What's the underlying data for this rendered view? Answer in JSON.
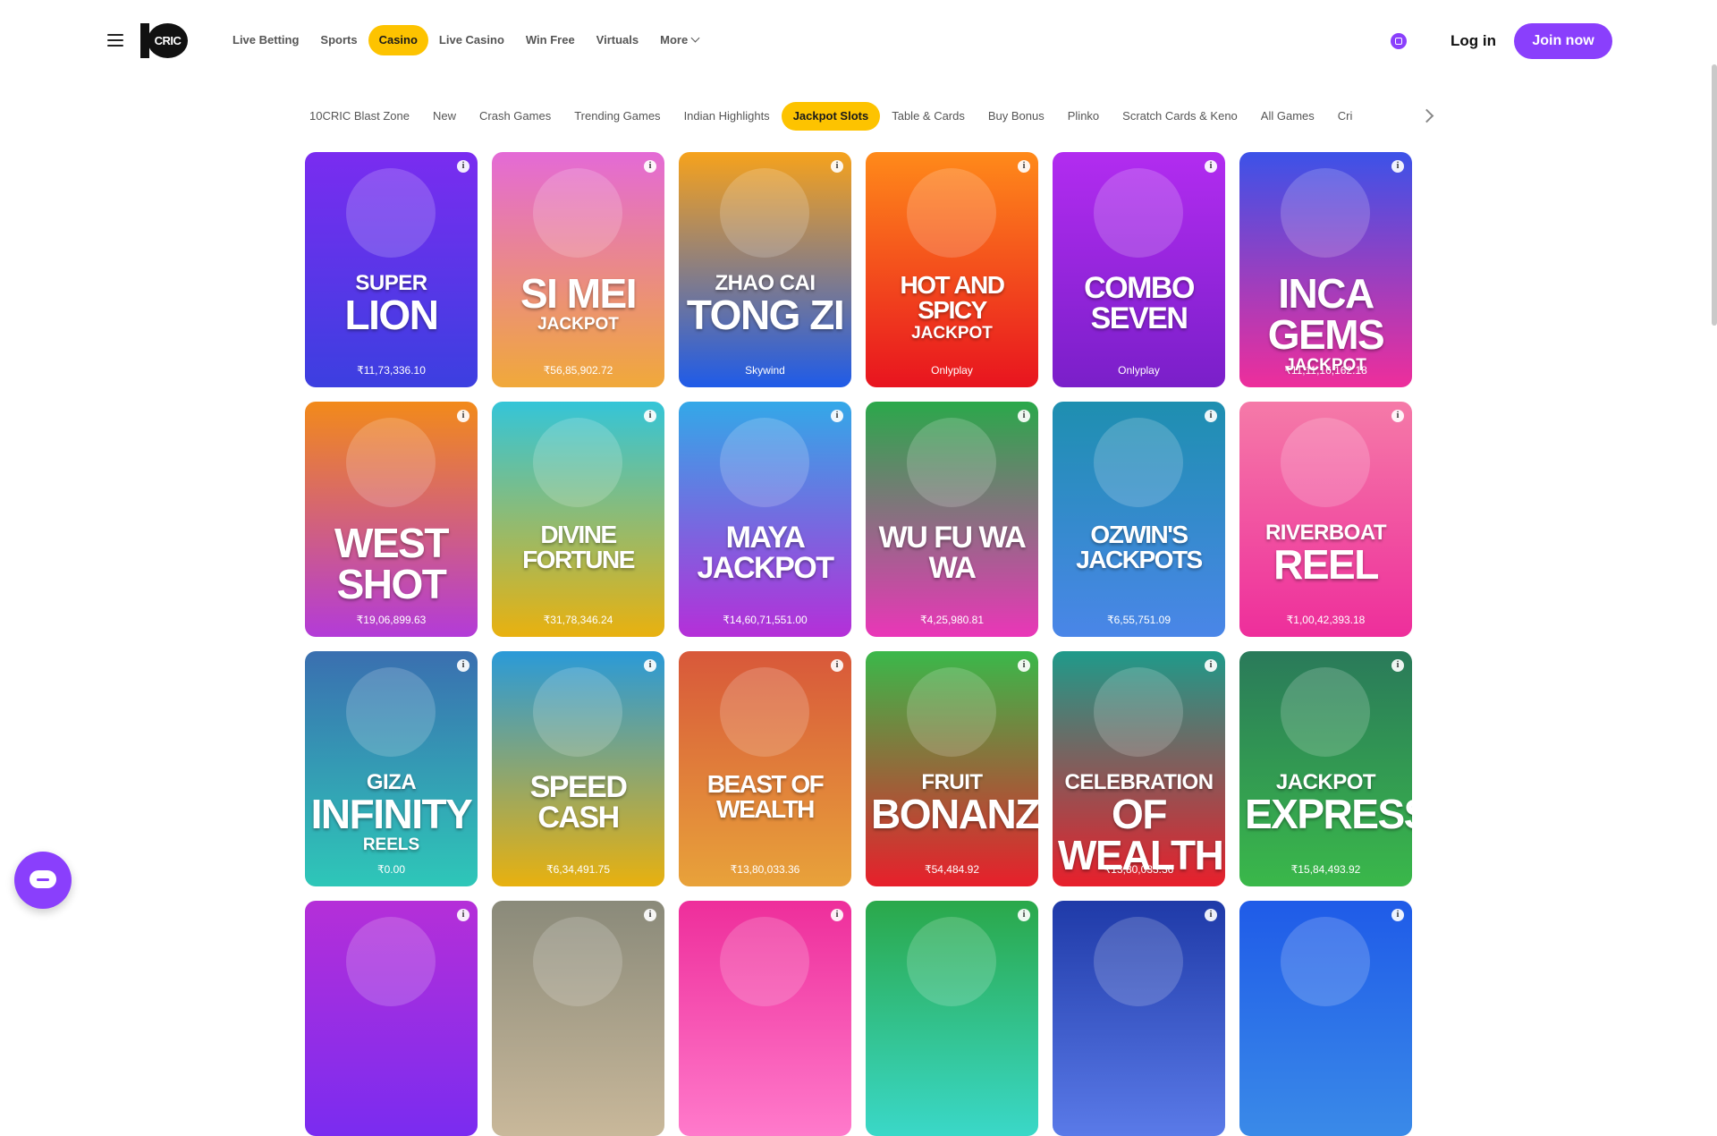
{
  "header": {
    "logo_text": "CRIC",
    "nav": [
      {
        "label": "Live Betting"
      },
      {
        "label": "Sports"
      },
      {
        "label": "Casino",
        "active": true
      },
      {
        "label": "Live Casino"
      },
      {
        "label": "Win Free"
      },
      {
        "label": "Virtuals"
      },
      {
        "label": "More"
      }
    ],
    "login_label": "Log in",
    "join_label": "Join now"
  },
  "tabs": [
    {
      "label": "10CRIC Blast Zone"
    },
    {
      "label": "New"
    },
    {
      "label": "Crash Games"
    },
    {
      "label": "Trending Games"
    },
    {
      "label": "Indian Highlights"
    },
    {
      "label": "Jackpot Slots",
      "active": true
    },
    {
      "label": "Table & Cards"
    },
    {
      "label": "Buy Bonus"
    },
    {
      "label": "Plinko"
    },
    {
      "label": "Scratch Cards & Keno"
    },
    {
      "label": "All Games"
    },
    {
      "label": "Cri"
    }
  ],
  "games": [
    {
      "top": "SUPER",
      "main": "LION",
      "sub": "",
      "meta": "₹11,73,336.10",
      "c1": "#7a2cf0",
      "c2": "#3c3fe0"
    },
    {
      "top": "",
      "main": "SI MEI",
      "sub": "JACKPOT",
      "meta": "₹56,85,902.72",
      "c1": "#e46ad6",
      "c2": "#f0a93a"
    },
    {
      "top": "ZHAO CAI",
      "main": "TONG ZI",
      "sub": "",
      "meta": "Skywind",
      "c1": "#f6a21c",
      "c2": "#1f5be8"
    },
    {
      "top": "",
      "main": "HOT AND SPICY",
      "sub": "JACKPOT",
      "meta": "Onlyplay",
      "c1": "#ff8a1a",
      "c2": "#e8141f"
    },
    {
      "top": "",
      "main": "COMBO SEVEN",
      "sub": "",
      "meta": "Onlyplay",
      "c1": "#b22cf0",
      "c2": "#7a1fc9"
    },
    {
      "top": "",
      "main": "INCA GEMS",
      "sub": "JACKPOT",
      "meta": "₹11,11,16,162.18",
      "c1": "#3c52e8",
      "c2": "#ee2e9b"
    },
    {
      "top": "",
      "main": "WEST SHOT",
      "sub": "",
      "meta": "₹19,06,899.63",
      "c1": "#f28a1a",
      "c2": "#b33bd8"
    },
    {
      "top": "",
      "main": "DIVINE FORTUNE",
      "sub": "",
      "meta": "₹31,78,346.24",
      "c1": "#34c5d8",
      "c2": "#e9b10f"
    },
    {
      "top": "",
      "main": "MAYA JACKPOT",
      "sub": "",
      "meta": "₹14,60,71,551.00",
      "c1": "#33a8e8",
      "c2": "#b52fd8"
    },
    {
      "top": "",
      "main": "WU FU WA WA",
      "sub": "",
      "meta": "₹4,25,980.81",
      "c1": "#2aa84a",
      "c2": "#ea36b8"
    },
    {
      "top": "",
      "main": "OZWIN'S JACKPOTS",
      "sub": "",
      "meta": "₹6,55,751.09",
      "c1": "#1e8fb0",
      "c2": "#4a86e8"
    },
    {
      "top": "RIVERBOAT",
      "main": "REEL",
      "sub": "",
      "meta": "₹1,00,42,393.18",
      "c1": "#f57aa8",
      "c2": "#ee2e9b"
    },
    {
      "top": "GIZA",
      "main": "INFINITY",
      "sub": "REELS",
      "meta": "₹0.00",
      "c1": "#3a6fb0",
      "c2": "#2ec7b8"
    },
    {
      "top": "",
      "main": "SPEED CASH",
      "sub": "",
      "meta": "₹6,34,491.75",
      "c1": "#2a9ad8",
      "c2": "#e8b10f"
    },
    {
      "top": "",
      "main": "BEAST OF WEALTH",
      "sub": "",
      "meta": "₹13,80,033.36",
      "c1": "#d8583a",
      "c2": "#e8a23a"
    },
    {
      "top": "FRUIT",
      "main": "BONANZA",
      "sub": "",
      "meta": "₹54,484.92",
      "c1": "#3ab84a",
      "c2": "#e81f2b"
    },
    {
      "top": "CELEBRATION",
      "main": "OF WEALTH",
      "sub": "",
      "meta": "₹13,80,033.36",
      "c1": "#1f9a8a",
      "c2": "#e81f2b"
    },
    {
      "top": "JACKPOT",
      "main": "EXPRESS",
      "sub": "",
      "meta": "₹15,84,493.92",
      "c1": "#2a7a5a",
      "c2": "#3ab84a"
    },
    {
      "top": "",
      "main": "",
      "sub": "",
      "meta": "",
      "c1": "#b52fd8",
      "c2": "#7a2cf0"
    },
    {
      "top": "",
      "main": "",
      "sub": "",
      "meta": "",
      "c1": "#8a8a7a",
      "c2": "#c9b89a"
    },
    {
      "top": "",
      "main": "",
      "sub": "",
      "meta": "",
      "c1": "#ee2e9b",
      "c2": "#ff7acb"
    },
    {
      "top": "",
      "main": "",
      "sub": "",
      "meta": "",
      "c1": "#2aa84a",
      "c2": "#3ad8c8"
    },
    {
      "top": "",
      "main": "",
      "sub": "",
      "meta": "",
      "c1": "#1f3aa8",
      "c2": "#5a7ae8"
    },
    {
      "top": "",
      "main": "",
      "sub": "",
      "meta": "",
      "c1": "#1f5be8",
      "c2": "#3a8ae8"
    }
  ],
  "colors": {
    "accent": "#fdc300",
    "brand": "#8a3ffc"
  }
}
